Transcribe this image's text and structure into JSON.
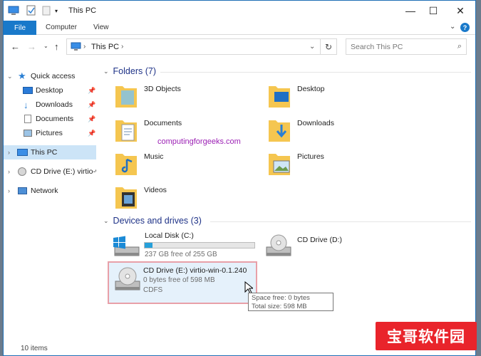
{
  "window": {
    "title": "This PC",
    "controls": {
      "minimize": "—",
      "maximize": "☐",
      "close": "✕"
    }
  },
  "ribbon": {
    "tabs": [
      "File",
      "Computer",
      "View"
    ],
    "expand_glyph": "⌄",
    "help_glyph": "?"
  },
  "address": {
    "path": "This PC",
    "search_placeholder": "Search This PC"
  },
  "nav": {
    "quick_access": "Quick access",
    "pinned": [
      "Desktop",
      "Downloads",
      "Documents",
      "Pictures"
    ],
    "this_pc": "This PC",
    "cd_drive": "CD Drive (E:) virtio-w",
    "network": "Network"
  },
  "folders": {
    "header": "Folders (7)",
    "items": [
      "3D Objects",
      "Desktop",
      "Documents",
      "Downloads",
      "Music",
      "Pictures",
      "Videos"
    ]
  },
  "devices": {
    "header": "Devices and drives (3)",
    "local_disk": {
      "name": "Local Disk (C:)",
      "free": "237 GB free of 255 GB",
      "used_fraction": 0.07
    },
    "cd_d": {
      "name": "CD Drive (D:)"
    },
    "cd_e": {
      "name": "CD Drive (E:) virtio-win-0.1.240",
      "free": "0 bytes free of 598 MB",
      "fs": "CDFS"
    }
  },
  "tooltip": {
    "line1": "Space free: 0 bytes",
    "line2": "Total size: 598 MB"
  },
  "overlay_text": "computingforgeeks.com",
  "status": {
    "count": "10 items"
  },
  "stamp": "宝哥软件园",
  "colors": {
    "accent": "#1979ca",
    "selection": "#cce4f7",
    "group_header": "#1e3287",
    "watermark": "#9b1fb4",
    "stamp": "#e9242b"
  }
}
